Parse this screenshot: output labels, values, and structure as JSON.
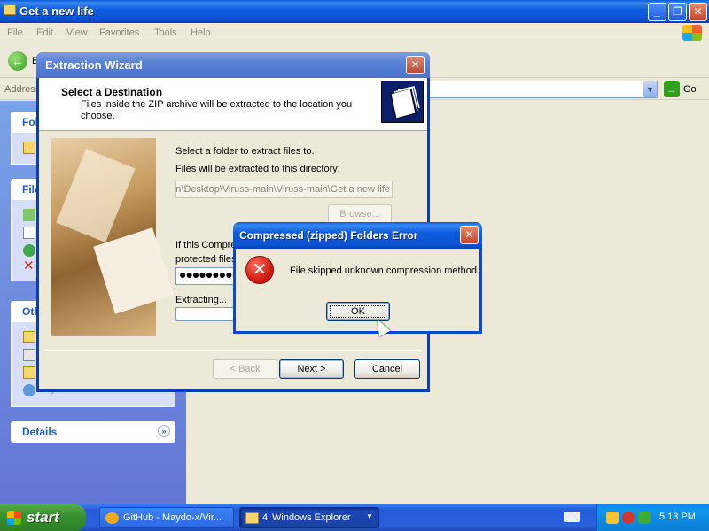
{
  "explorer": {
    "title": "Get a new life",
    "menu": [
      "File",
      "Edit",
      "View",
      "Favorites",
      "Tools",
      "Help"
    ],
    "toolbar": {
      "back_label": "B"
    },
    "address": {
      "label": "Address",
      "go_label": "Go"
    },
    "taskpane": {
      "file_folder_tasks_head": "Fol",
      "file_tasks_head": "File",
      "other_places_head": "Oth",
      "network_places_label": "My Network Places",
      "details_head": "Details"
    }
  },
  "wizard": {
    "title": "Extraction Wizard",
    "header_title": "Select a Destination",
    "header_subtitle": "Files inside the ZIP archive will be extracted to the location you choose.",
    "select_folder_text": "Select a folder to extract files to.",
    "directory_label": "Files will be extracted to this directory:",
    "directory_value": "Admin\\Desktop\\Viruss-main\\Viruss-main\\Get a new life",
    "browse_label": "Browse...",
    "compressed_text_1": "If this Compres",
    "compressed_text_2": "protected files,",
    "password_value": "●●●●●●●●●",
    "extracting_label": "Extracting...",
    "back_label": "< Back",
    "next_label": "Next >",
    "cancel_label": "Cancel"
  },
  "error_dialog": {
    "title": "Compressed (zipped) Folders Error",
    "message": "File skipped unknown compression method.",
    "ok_label": "OK",
    "icon": "error-icon"
  },
  "taskbar": {
    "start_label": "start",
    "tasks": [
      {
        "label": "GitHub - Maydo-x/Vir...",
        "icon": "browser-icon"
      },
      {
        "count": "4",
        "label": "Windows Explorer",
        "icon": "folder-icon"
      }
    ],
    "clock": "5:13 PM"
  },
  "colors": {
    "xp_blue": "#0A5BD8",
    "task_pane_blue": "#6375D6",
    "start_green": "#37922F",
    "error_red": "#C8140A"
  }
}
